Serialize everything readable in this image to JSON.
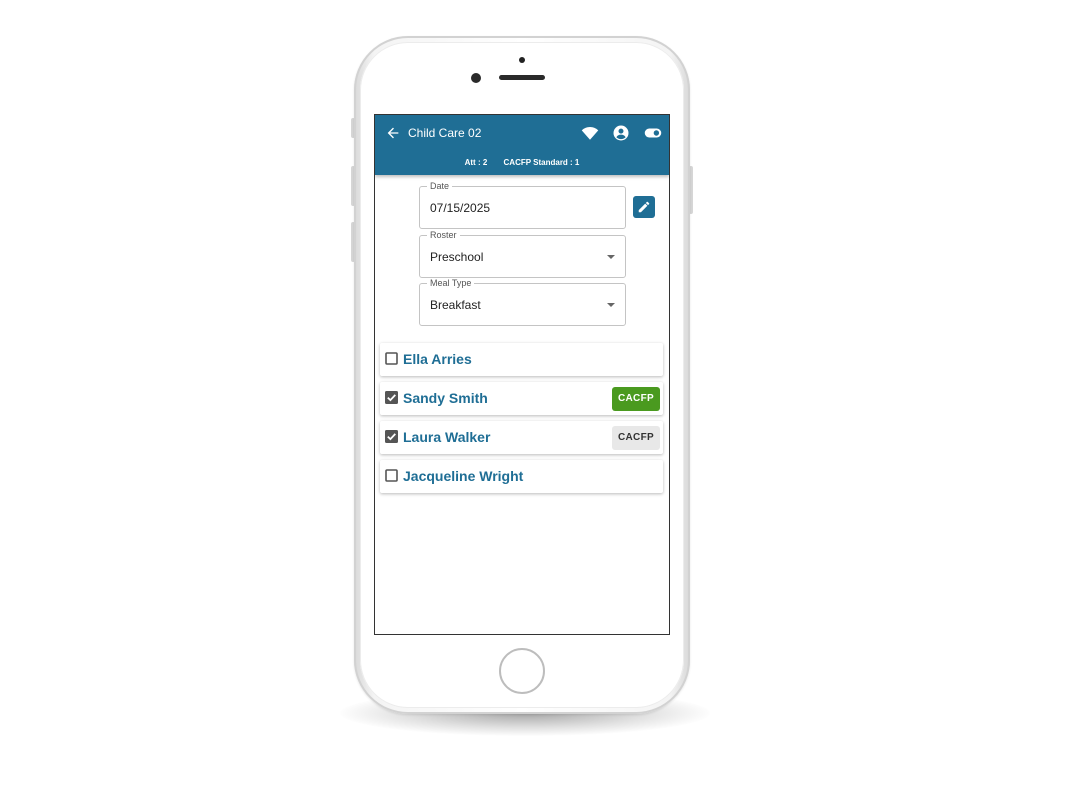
{
  "appbar": {
    "title": "Child Care 02",
    "back_icon": "arrow-left-icon",
    "icons": [
      "wifi-icon",
      "account-circle-icon",
      "toggle-icon"
    ],
    "attendance": "Att : 2",
    "cacfp_standard": "CACFP Standard : 1",
    "color": "#1f6e95"
  },
  "form": {
    "date": {
      "label": "Date",
      "value": "07/15/2025"
    },
    "roster": {
      "label": "Roster",
      "value": "Preschool"
    },
    "meal_type": {
      "label": "Meal Type",
      "value": "Breakfast"
    }
  },
  "children": [
    {
      "name": "Ella Arries",
      "checked": false,
      "cacfp_label": "",
      "cacfp_active": false
    },
    {
      "name": "Sandy Smith",
      "checked": true,
      "cacfp_label": "CACFP",
      "cacfp_active": true
    },
    {
      "name": "Laura Walker",
      "checked": true,
      "cacfp_label": "CACFP",
      "cacfp_active": false
    },
    {
      "name": "Jacqueline Wright",
      "checked": false,
      "cacfp_label": "",
      "cacfp_active": false
    }
  ],
  "colors": {
    "primary": "#1f6e95",
    "cacfp_active": "#4a9a1f",
    "cacfp_inactive": "#e8e8e8"
  }
}
